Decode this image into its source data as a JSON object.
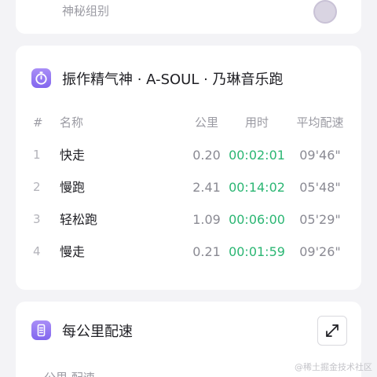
{
  "top_card": {
    "subtitle": "神秘组别"
  },
  "run_card": {
    "icon": "stopwatch-icon",
    "title": "振作精气神 · A-SOUL · 乃琳音乐跑",
    "columns": {
      "index": "#",
      "name": "名称",
      "distance": "公里",
      "duration": "用时",
      "pace": "平均配速"
    },
    "rows": [
      {
        "index": "1",
        "name": "快走",
        "distance": "0.20",
        "duration": "00:02:01",
        "pace": "09'46\""
      },
      {
        "index": "2",
        "name": "慢跑",
        "distance": "2.41",
        "duration": "00:14:02",
        "pace": "05'48\""
      },
      {
        "index": "3",
        "name": "轻松跑",
        "distance": "1.09",
        "duration": "00:06:00",
        "pace": "05'29\""
      },
      {
        "index": "4",
        "name": "慢走",
        "distance": "0.21",
        "duration": "00:01:59",
        "pace": "09'26\""
      }
    ]
  },
  "pace_card": {
    "icon": "list-chart-icon",
    "title": "每公里配速",
    "expand_icon": "expand-icon",
    "sub_header": "公里 配速"
  },
  "watermark": "@稀土掘金技术社区",
  "colors": {
    "accent_purple": "#8a6cf1",
    "time_green": "#2bb673",
    "background": "#f3f3f6"
  }
}
